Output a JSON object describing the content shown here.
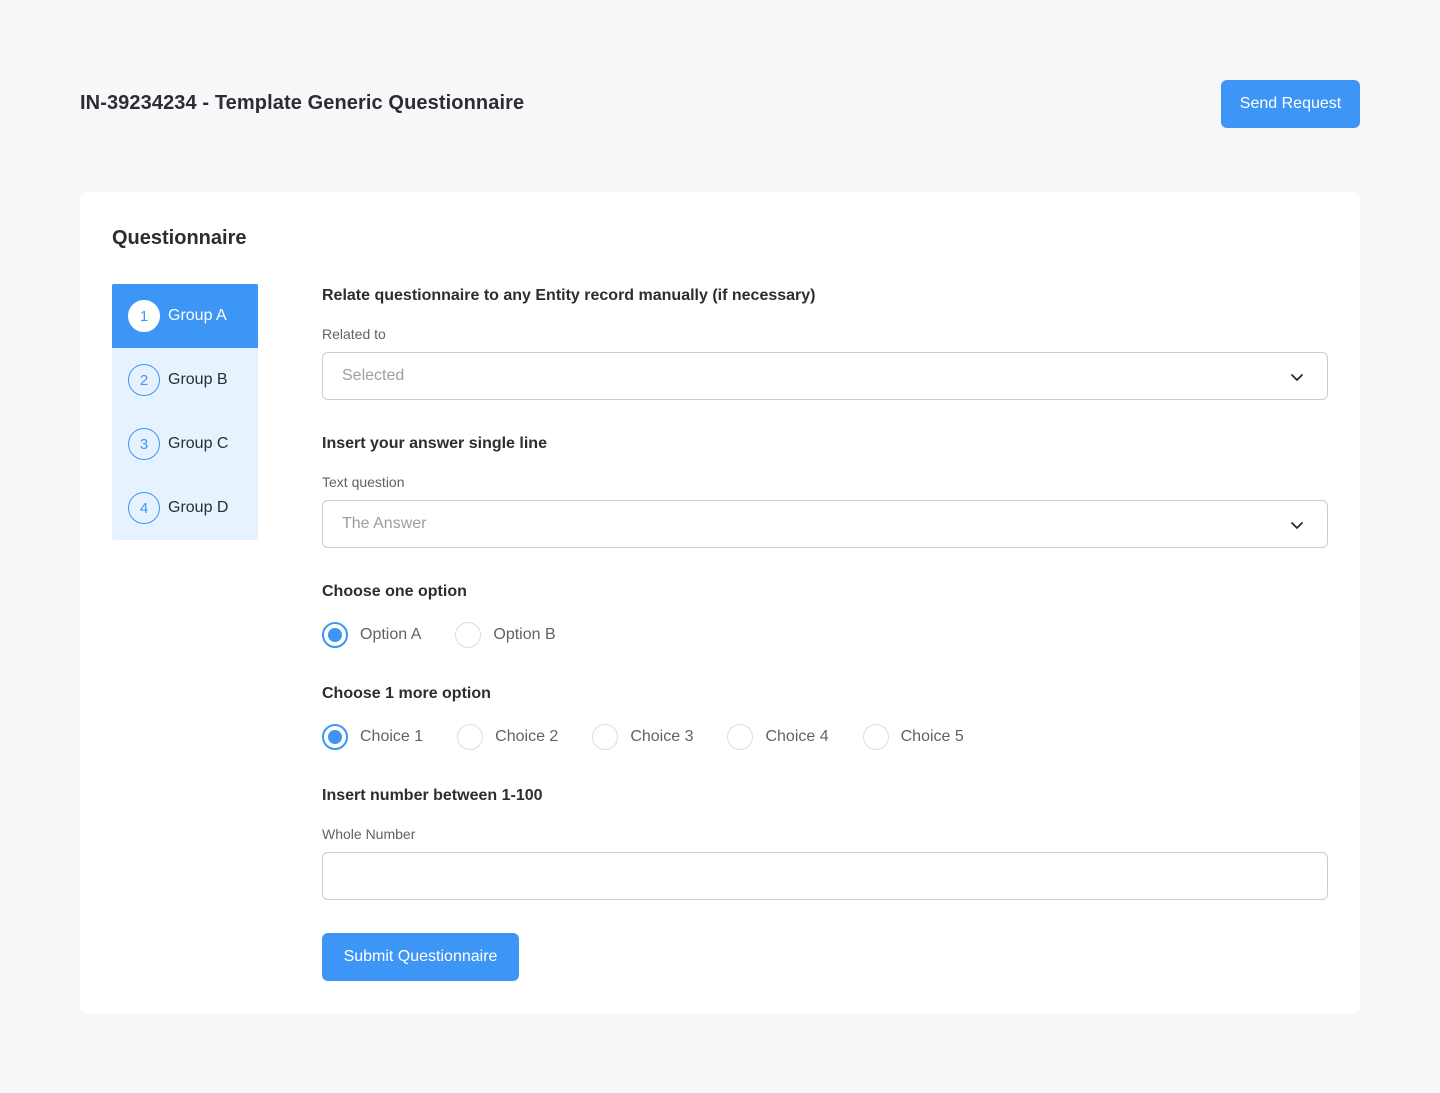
{
  "header": {
    "title": "IN-39234234 - Template Generic Questionnaire",
    "send_label": "Send Request"
  },
  "card": {
    "title": "Questionnaire"
  },
  "steps": [
    {
      "number": "1",
      "label": "Group A",
      "active": true
    },
    {
      "number": "2",
      "label": "Group B",
      "active": false
    },
    {
      "number": "3",
      "label": "Group C",
      "active": false
    },
    {
      "number": "4",
      "label": "Group D",
      "active": false
    }
  ],
  "form": {
    "related": {
      "section_title": "Relate questionnaire to any Entity record manually (if necessary)",
      "label": "Related to",
      "value": "Selected"
    },
    "text_question": {
      "section_title": "Insert your answer single line",
      "label": "Text question",
      "value": "The Answer"
    },
    "choose_one": {
      "section_title": "Choose one option",
      "options": [
        "Option A",
        "Option B"
      ],
      "selected": "Option A"
    },
    "choose_more": {
      "section_title": "Choose 1 more option",
      "options": [
        "Choice 1",
        "Choice 2",
        "Choice 3",
        "Choice 4",
        "Choice 5"
      ],
      "selected": "Choice 1"
    },
    "number": {
      "section_title": "Insert number between 1-100",
      "label": "Whole Number",
      "value": ""
    },
    "submit_label": "Submit Questionnaire"
  },
  "colors": {
    "accent": "#3d96f5",
    "step_background": "#e6f2fd",
    "page_background": "#f7f8f9"
  },
  "icons": {
    "dropdown": "chevron-down-icon"
  }
}
